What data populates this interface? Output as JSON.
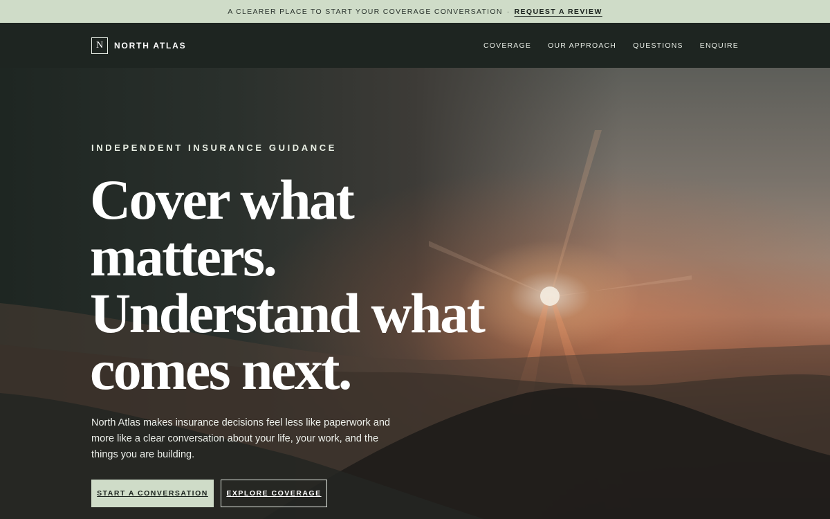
{
  "banner": {
    "text": "A CLEARER PLACE TO START YOUR COVERAGE CONVERSATION",
    "separator": "·",
    "link": "REQUEST A REVIEW"
  },
  "nav": {
    "logo_mark": "N",
    "brand": "NORTH ATLAS",
    "links": [
      "COVERAGE",
      "OUR APPROACH",
      "QUESTIONS",
      "ENQUIRE"
    ]
  },
  "hero": {
    "eyebrow": "INDEPENDENT INSURANCE GUIDANCE",
    "headline_lines": [
      "Cover what",
      "matters.",
      "Understand what",
      "comes next."
    ],
    "lede": "North Atlas makes insurance decisions feel less like paperwork and more like a clear conversation about your life, your work, and the things you are building.",
    "primary_cta": "START A CONVERSATION",
    "secondary_cta": "EXPLORE COVERAGE"
  },
  "colors": {
    "accent": "#cfdcc8",
    "nav_bg": "#1e2521",
    "text_light": "#ffffff"
  }
}
